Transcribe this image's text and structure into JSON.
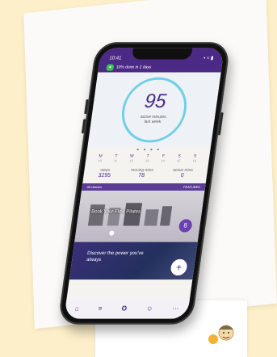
{
  "app": {
    "status_bar": {
      "time": "10:41",
      "icons": "▪ ≈ ▮"
    },
    "banner": {
      "text": "10% done in 2 days",
      "chip": "●"
    },
    "summary": {
      "value": "95",
      "line1": "active minutes",
      "line2": "last week",
      "dots": "● ● ● ●"
    },
    "week": [
      {
        "day": "M",
        "date": "10"
      },
      {
        "day": "T",
        "date": "11"
      },
      {
        "day": "W",
        "date": "12"
      },
      {
        "day": "T",
        "date": "13"
      },
      {
        "day": "F",
        "date": "14"
      },
      {
        "day": "S",
        "date": "15"
      },
      {
        "day": "S",
        "date": "16"
      }
    ],
    "stats": [
      {
        "label": "steps",
        "value": "3295"
      },
      {
        "label": "moving mins",
        "value": "78"
      },
      {
        "label": "active mins",
        "value": "0"
      }
    ],
    "promo_tile": {
      "header_left": "All classes",
      "header_right": "FEATURED",
      "title": "Book Your Flow Pilates",
      "badge": "8"
    },
    "explore_tile": {
      "text": "Discover the power you've always",
      "fab": "+"
    },
    "tabbar": [
      "⌂",
      "≡",
      "✪",
      "☺",
      "⋯"
    ]
  },
  "colors": {
    "brand": "#4b2a86",
    "ring": "#6fd0e6",
    "chip": "#3fbf5a",
    "background": "#fcefc9"
  }
}
